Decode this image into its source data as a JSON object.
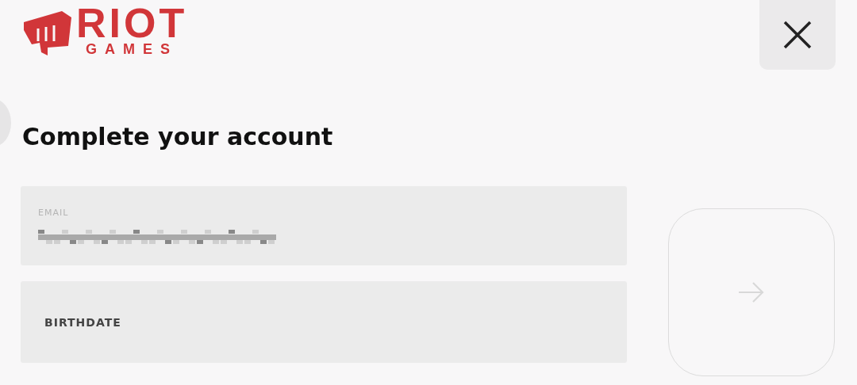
{
  "logo": {
    "line_1": "RIOT",
    "line_2": "GAMES"
  },
  "title": "Complete your account",
  "fields": [
    {
      "kind": "email",
      "label": "EMAIL",
      "redacted": true
    },
    {
      "kind": "birthdate",
      "placeholder": "BIRTHDATE"
    }
  ],
  "submit": {
    "disabled": true
  }
}
